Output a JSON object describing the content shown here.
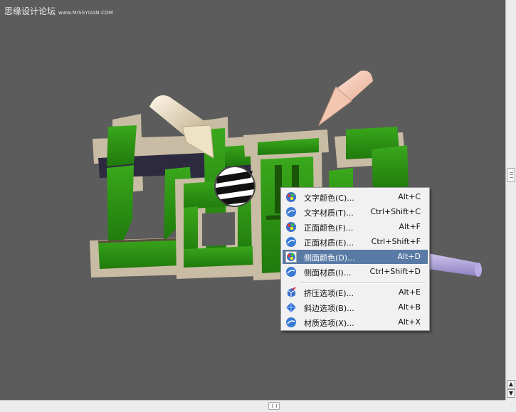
{
  "watermark": {
    "chinese": "思缘设计论坛",
    "english": "www.MISSYUAN.COM"
  },
  "menu": {
    "items": [
      {
        "label": "文字颜色(C)...",
        "shortcut": "Alt+C",
        "icon": "color-palette-icon"
      },
      {
        "label": "文字材质(T)...",
        "shortcut": "Ctrl+Shift+C",
        "icon": "material-sphere-icon"
      },
      {
        "label": "正面颜色(F)...",
        "shortcut": "Alt+F",
        "icon": "color-palette-icon"
      },
      {
        "label": "正面材质(E)...",
        "shortcut": "Ctrl+Shift+F",
        "icon": "material-sphere-icon"
      },
      {
        "label": "侧面颜色(D)...",
        "shortcut": "Alt+D",
        "icon": "color-palette-icon",
        "highlighted": true
      },
      {
        "label": "侧面材质(I)...",
        "shortcut": "Ctrl+Shift+D",
        "icon": "material-sphere-icon"
      },
      {
        "label": "挤压选项(E)...",
        "shortcut": "Alt+E",
        "icon": "extrude-cube-icon"
      },
      {
        "label": "斜边选项(B)...",
        "shortcut": "Alt+B",
        "icon": "bevel-diamond-icon"
      },
      {
        "label": "材质选项(X)...",
        "shortcut": "Alt+X",
        "icon": "material-sphere-icon"
      }
    ]
  },
  "colors": {
    "canvas": "#5c5c5c",
    "menu_highlight": "#5a7aa6",
    "text_front": "#2a8c12",
    "text_side": "#cdbfa7"
  }
}
